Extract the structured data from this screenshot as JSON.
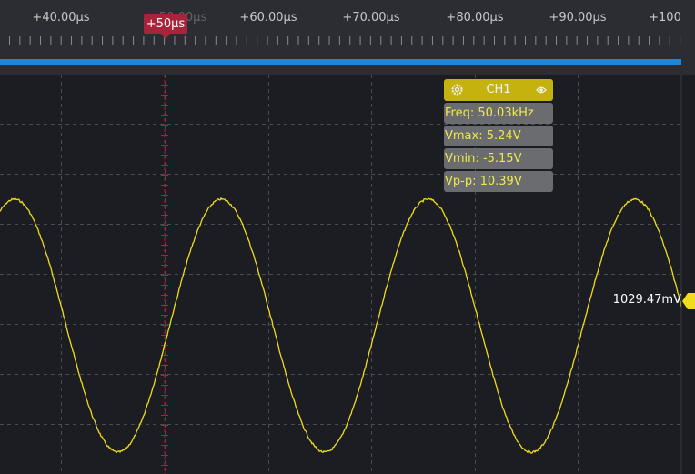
{
  "ruler": {
    "tick_labels": [
      "+40.00µs",
      "+50.00µs",
      "+60.00µs",
      "+70.00µs",
      "+80.00µs",
      "+90.00µs",
      "+100"
    ]
  },
  "time_cursor": {
    "label": "+50µs",
    "ghost_label": "+50.00µs"
  },
  "measurement_panel": {
    "channel": "CH1",
    "header_color": "#c4b30f",
    "icons": [
      "gear-icon",
      "eye-icon"
    ],
    "rows": [
      {
        "label": "Freq:",
        "value": "50.03kHz"
      },
      {
        "label": "Vmax:",
        "value": "5.24V"
      },
      {
        "label": "Vmin:",
        "value": "-5.15V"
      },
      {
        "label": "Vp-p:",
        "value": "10.39V"
      }
    ]
  },
  "trigger_level": {
    "readout": "1029.47mV",
    "color": "#f0dc1a"
  },
  "colors": {
    "trace": "#f0dc1a",
    "cursor": "#a8243a",
    "overview": "#1f86d8",
    "background": "#1b1d23"
  },
  "chart_data": {
    "type": "line",
    "x_unit": "µs",
    "frequency_khz": 50.03,
    "vmax_v": 5.24,
    "vmin_v": -5.15,
    "vpp_v": 10.39,
    "grid": true,
    "legend": "none"
  }
}
